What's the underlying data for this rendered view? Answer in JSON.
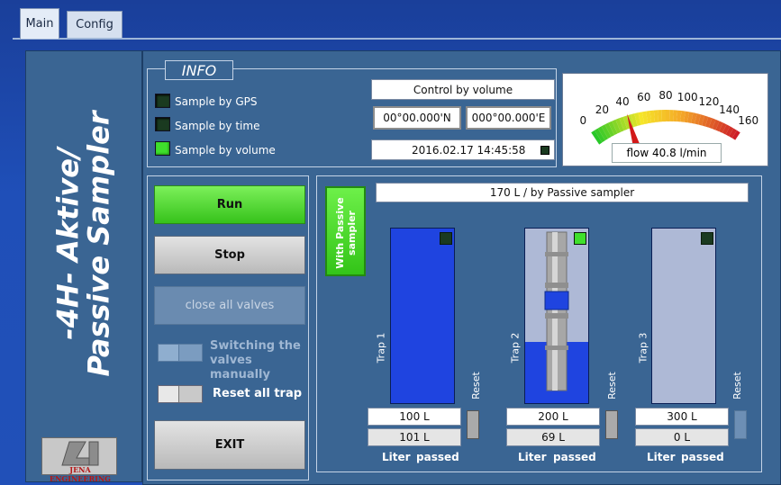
{
  "tabs": [
    {
      "label": "Main"
    },
    {
      "label": "Config"
    }
  ],
  "side": {
    "title": "-4H- Aktive/Passive Sampler",
    "logo_text": "JENA ENGINEERING"
  },
  "info": {
    "legend": "INFO",
    "leds": [
      {
        "label": "Sample by GPS",
        "on": false
      },
      {
        "label": "Sample by time",
        "on": false
      },
      {
        "label": "Sample by volume",
        "on": true
      }
    ],
    "mode": "Control by volume",
    "latitude": "00°00.000'N",
    "longitude": "000°00.000'E",
    "datetime": "2016.02.17 14:45:58"
  },
  "gauge": {
    "ticks": [
      "0",
      "20",
      "40",
      "60",
      "80",
      "100",
      "120",
      "140",
      "160"
    ],
    "value": 40.8,
    "max": 160,
    "readout": "flow 40.8 l/min"
  },
  "controls": {
    "run": "Run",
    "stop": "Stop",
    "close_valves": "close all valves",
    "switching_label": "Switching the valves manually",
    "reset_label": "Reset all trap",
    "exit": "EXIT"
  },
  "sampler": {
    "passive_toggle": "With Passive sampler",
    "status": "170 L / by Passive sampler",
    "traps": [
      {
        "name": "Trap 1",
        "target": "100 L",
        "passed": "101 L",
        "fill": 1.0,
        "led_on": false
      },
      {
        "name": "Trap 2",
        "target": "200 L",
        "passed": "69 L",
        "fill": 0.35,
        "led_on": true
      },
      {
        "name": "Trap 3",
        "target": "300 L",
        "passed": "0 L",
        "fill": 0.0,
        "led_on": false
      }
    ],
    "reset_label": "Reset",
    "liter_label": "Liter",
    "passed_label": "passed"
  },
  "colors": {
    "panel": "#3a6593",
    "led_on": "#3fdf2c",
    "tank_fill": "#1f44e0",
    "tank_empty": "#aeb9d6"
  }
}
